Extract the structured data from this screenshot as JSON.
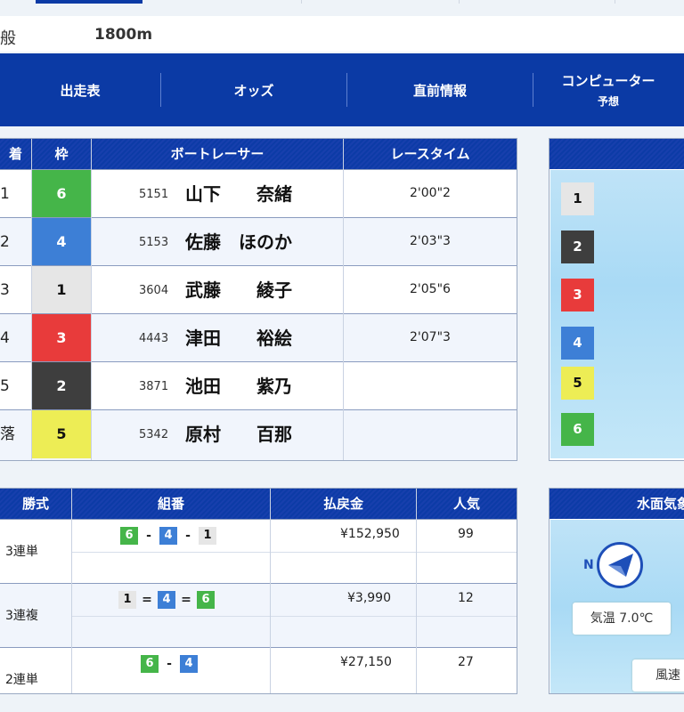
{
  "race": {
    "class_label": "般",
    "distance": "1800m"
  },
  "nav": {
    "tabs": [
      {
        "label": "出走表"
      },
      {
        "label": "オッズ"
      },
      {
        "label": "直前情報"
      },
      {
        "label": "コンピューター",
        "sub": "予想"
      }
    ]
  },
  "result_table": {
    "headers": {
      "rank": "着",
      "frame": "枠",
      "racer": "ボートレーサー",
      "time": "レースタイム"
    },
    "rows": [
      {
        "rank": "1",
        "frame": "6",
        "reg_no": "5151",
        "name": "山下　　奈緒",
        "time": "2'00\"2"
      },
      {
        "rank": "2",
        "frame": "4",
        "reg_no": "5153",
        "name": "佐藤　ほのか",
        "time": "2'03\"3"
      },
      {
        "rank": "3",
        "frame": "1",
        "reg_no": "3604",
        "name": "武藤　　綾子",
        "time": "2'05\"6"
      },
      {
        "rank": "4",
        "frame": "3",
        "reg_no": "4443",
        "name": "津田　　裕絵",
        "time": "2'07\"3"
      },
      {
        "rank": "5",
        "frame": "2",
        "reg_no": "3871",
        "name": "池田　　紫乃",
        "time": ""
      },
      {
        "rank": "落",
        "frame": "5",
        "reg_no": "5342",
        "name": "原村　　百那",
        "time": ""
      }
    ]
  },
  "frame_colors": {
    "1": {
      "bg": "#e6e6e6",
      "fg": "#111111"
    },
    "2": {
      "bg": "#3e3e3e",
      "fg": "#ffffff"
    },
    "3": {
      "bg": "#e83b3b",
      "fg": "#ffffff"
    },
    "4": {
      "bg": "#3d7fd6",
      "fg": "#ffffff"
    },
    "5": {
      "bg": "#eded55",
      "fg": "#111111"
    },
    "6": {
      "bg": "#45b549",
      "fg": "#ffffff"
    }
  },
  "course_panel": {
    "boats": [
      "1",
      "2",
      "3",
      "4",
      "5",
      "6"
    ]
  },
  "payout_table": {
    "headers": {
      "type": "勝式",
      "combo": "組番",
      "amount": "払戻金",
      "pop": "人気"
    },
    "groups": [
      {
        "type": "3連単",
        "combo": [
          "6",
          "4",
          "1"
        ],
        "op": "-",
        "amount": "¥152,950",
        "pop": "99"
      },
      {
        "type": "3連複",
        "combo": [
          "1",
          "4",
          "6"
        ],
        "op": "=",
        "amount": "¥3,990",
        "pop": "12"
      },
      {
        "type": "2連単",
        "combo": [
          "6",
          "4"
        ],
        "op": "-",
        "amount": "¥27,150",
        "pop": "27"
      }
    ]
  },
  "weather": {
    "title": "水面気象",
    "north_label": "N",
    "temp_label": "気温",
    "temp_value": "7.0℃",
    "wind_label": "風速"
  }
}
